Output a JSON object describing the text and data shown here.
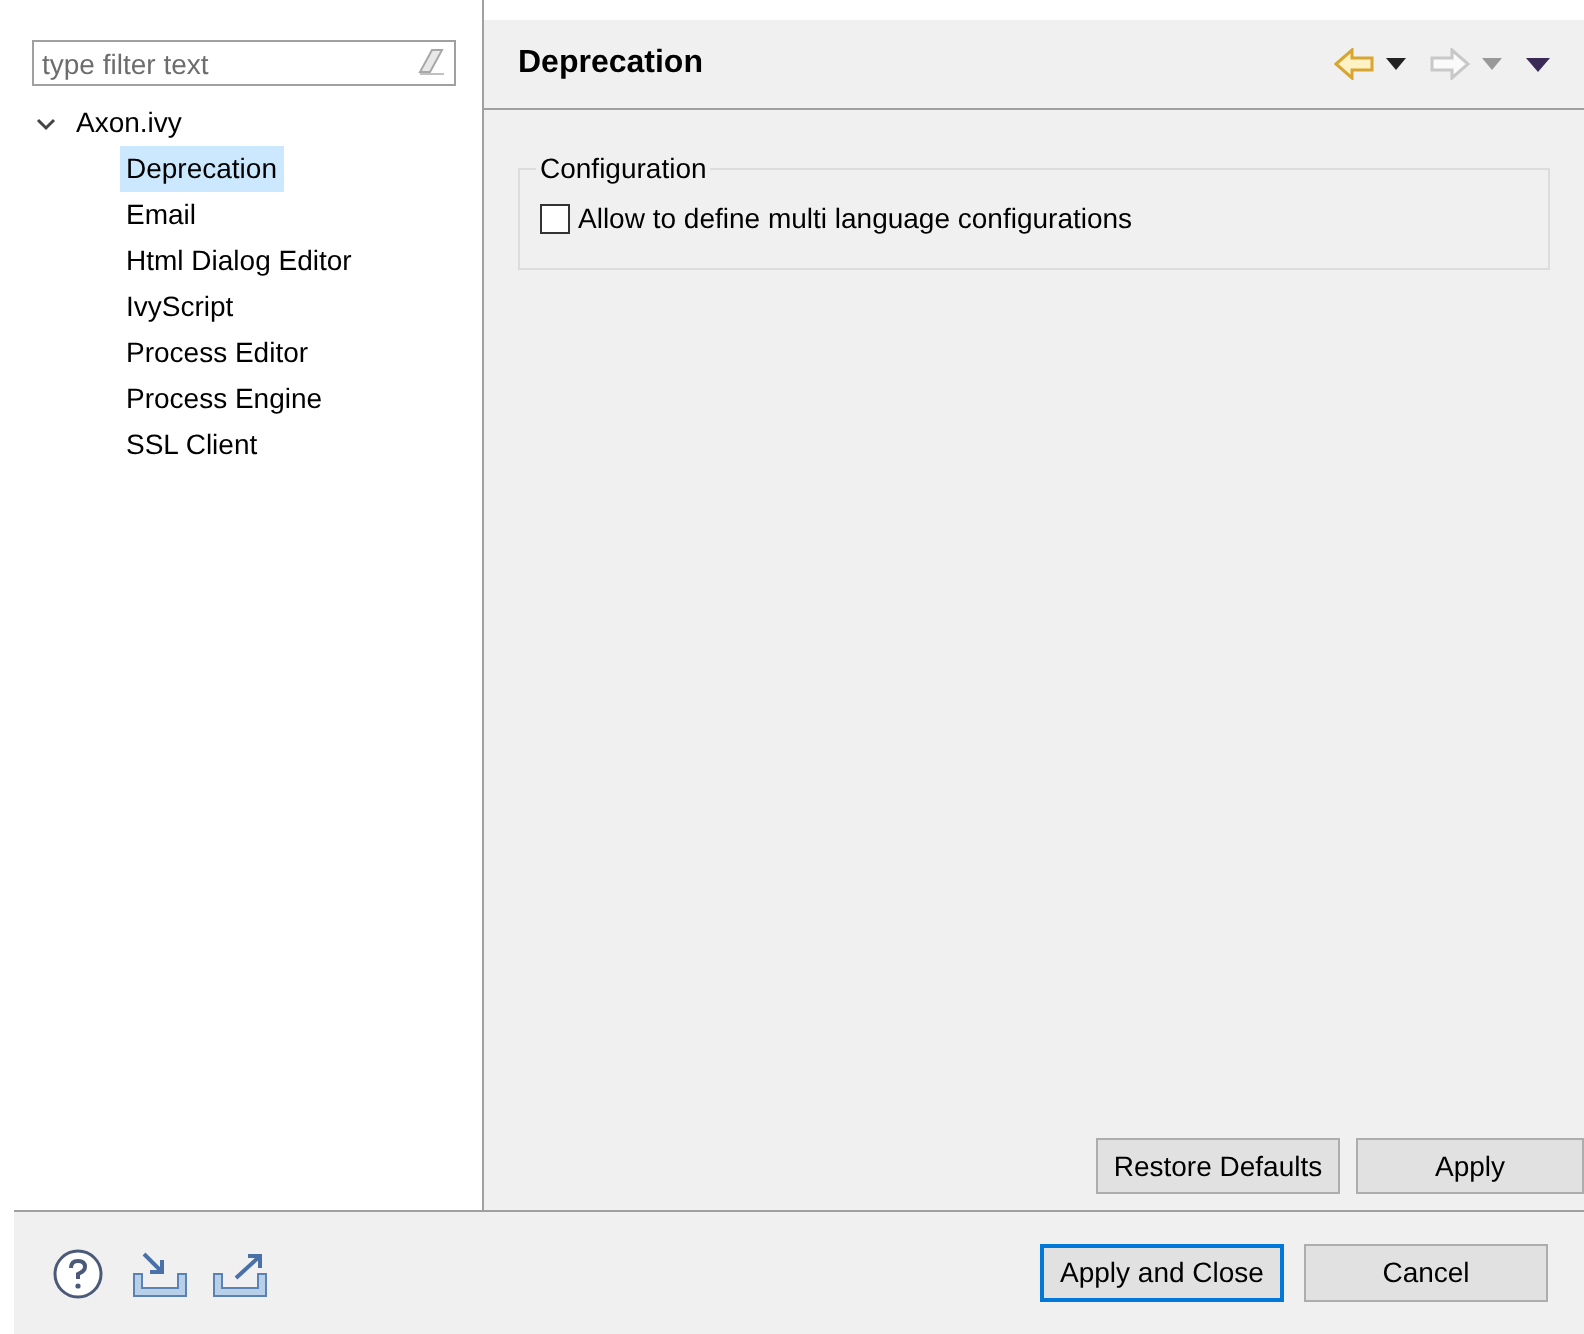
{
  "filter": {
    "placeholder": "type filter text"
  },
  "tree": [
    {
      "label": "Axon.ivy",
      "expanded": true,
      "selected": false,
      "children": [
        {
          "label": "Deprecation",
          "selected": true
        },
        {
          "label": "Email",
          "selected": false
        },
        {
          "label": "Html Dialog Editor",
          "selected": false
        },
        {
          "label": "IvyScript",
          "selected": false
        },
        {
          "label": "Process Editor",
          "selected": false
        },
        {
          "label": "Process Engine",
          "selected": false
        },
        {
          "label": "SSL Client",
          "selected": false
        }
      ]
    }
  ],
  "page": {
    "title": "Deprecation",
    "group": {
      "title": "Configuration",
      "options": [
        {
          "label": "Allow to define multi language configurations",
          "checked": false
        }
      ]
    },
    "buttons": [
      "Restore Defaults",
      "Apply"
    ]
  },
  "dialog_buttons": [
    {
      "label": "Apply and Close",
      "default": true
    },
    {
      "label": "Cancel",
      "default": false
    }
  ]
}
